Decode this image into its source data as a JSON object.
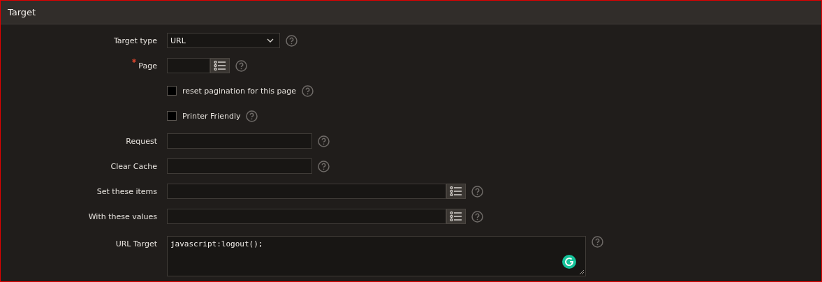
{
  "region": {
    "title": "Target"
  },
  "fields": [
    {
      "kind": "select",
      "label": "Target type",
      "value": "URL"
    },
    {
      "kind": "page-popup",
      "label": "Page",
      "required": true
    },
    {
      "kind": "checkbox",
      "label": "reset pagination for this page",
      "checked": false
    },
    {
      "kind": "checkbox",
      "label": "Printer Friendly",
      "checked": false
    },
    {
      "kind": "text",
      "label": "Request"
    },
    {
      "kind": "text",
      "label": "Clear Cache"
    },
    {
      "kind": "item-popup",
      "label": "Set these items"
    },
    {
      "kind": "item-popup",
      "label": "With these values"
    },
    {
      "kind": "textarea",
      "label": "URL Target",
      "value": "javascript:logout();"
    }
  ]
}
